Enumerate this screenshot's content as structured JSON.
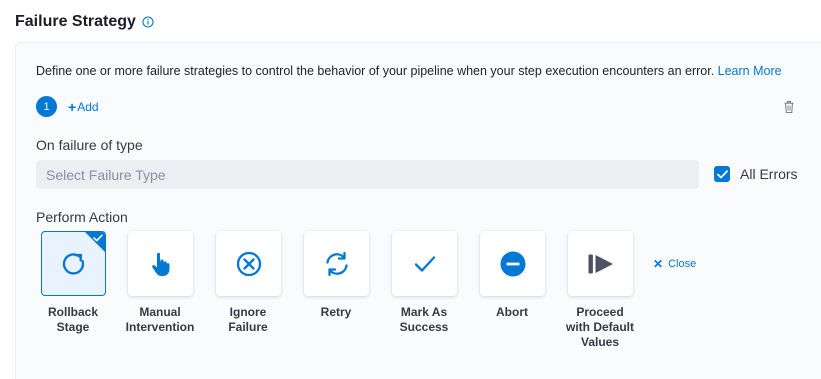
{
  "header": {
    "title": "Failure Strategy",
    "info_icon": "info-icon"
  },
  "description": {
    "text": "Define one or more failure strategies to control the behavior of your pipeline when your step execution encounters an error.",
    "link": "Learn More"
  },
  "strategies": {
    "active_step": "1",
    "add_label": "Add"
  },
  "failure_type": {
    "label": "On failure of type",
    "placeholder": "Select Failure Type",
    "all_errors_label": "All Errors",
    "all_errors_checked": true
  },
  "perform_action": {
    "label": "Perform Action",
    "actions": [
      {
        "line1": "Rollback",
        "line2": "Stage",
        "line3": "",
        "icon": "rollback-icon",
        "selected": true
      },
      {
        "line1": "Manual",
        "line2": "Intervention",
        "line3": "",
        "icon": "hand-pointer-icon",
        "selected": false
      },
      {
        "line1": "Ignore",
        "line2": "Failure",
        "line3": "",
        "icon": "circle-x-icon",
        "selected": false
      },
      {
        "line1": "Retry",
        "line2": "",
        "line3": "",
        "icon": "retry-icon",
        "selected": false
      },
      {
        "line1": "Mark As",
        "line2": "Success",
        "line3": "",
        "icon": "checkmark-icon",
        "selected": false
      },
      {
        "line1": "Abort",
        "line2": "",
        "line3": "",
        "icon": "abort-icon",
        "selected": false
      },
      {
        "line1": "Proceed",
        "line2": "with Default",
        "line3": "Values",
        "icon": "proceed-icon",
        "selected": false
      }
    ],
    "close_label": "Close"
  },
  "colors": {
    "accent": "#0278d5",
    "panel_bg": "#fafbfc",
    "select_bg": "#eceef2"
  }
}
